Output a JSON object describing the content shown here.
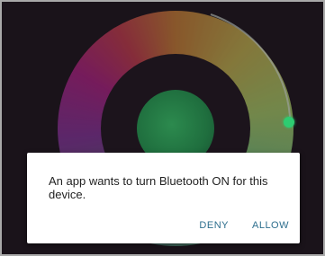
{
  "dialog": {
    "message": "An app wants to turn Bluetooth ON for this device.",
    "deny_label": "DENY",
    "allow_label": "ALLOW"
  },
  "colors": {
    "background": "#1a131a",
    "dialog_background": "#ffffff",
    "button_text": "#2e6f8e",
    "handle": "#2ecc71"
  },
  "icons": {
    "color_wheel": "color-wheel-icon",
    "wheel_handle": "slider-handle"
  }
}
